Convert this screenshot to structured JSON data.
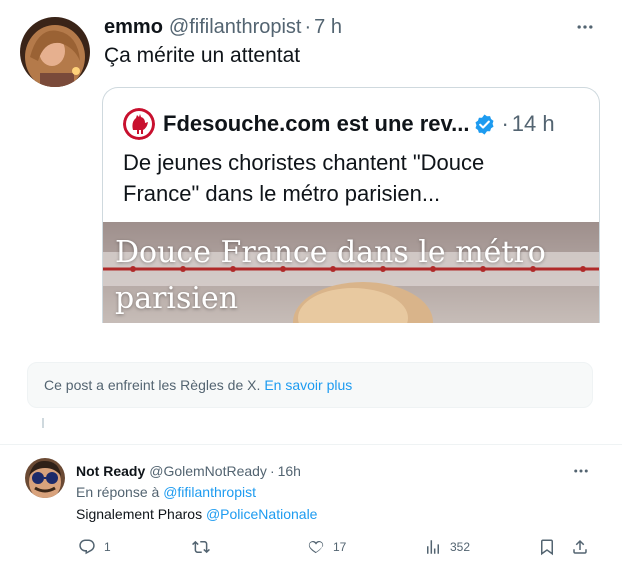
{
  "tweet": {
    "author_name": "emmo",
    "author_handle": "@fifilanthropist",
    "separator": "·",
    "time": "7 h",
    "text": "Ça mérite un attentat",
    "more_icon": "more-horizontal-icon"
  },
  "quote": {
    "author_name": "Fdesouche.com est une rev...",
    "verified_icon": "verified-badge-icon",
    "separator": "·",
    "time": "14 h",
    "text": "De jeunes choristes chantent \"Douce France\" dans le métro parisien...",
    "media_caption": "Douce France dans le métro parisien"
  },
  "notice": {
    "text": "Ce post a enfreint les Règles de X.",
    "link": "En savoir plus"
  },
  "reply": {
    "author_name": "Not Ready",
    "author_handle": "@GolemNotReady",
    "separator": "·",
    "time": "16h",
    "reply_prefix": "En réponse à",
    "reply_to": "@fifilanthropist",
    "text": "Signalement Pharos",
    "mention": "@PoliceNationale",
    "actions": {
      "replies": "1",
      "reposts": "",
      "likes": "17",
      "views": "352"
    }
  },
  "colors": {
    "accent": "#1d9bf0",
    "text": "#0f1419",
    "secondary": "#536471",
    "border": "#cfd9de"
  }
}
